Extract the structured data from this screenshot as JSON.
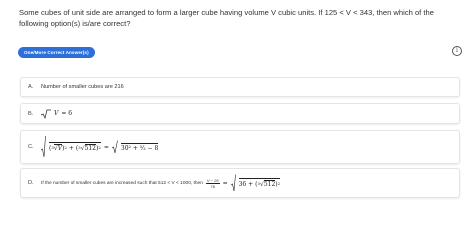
{
  "question": {
    "text": "Some cubes of unit side are arranged to form a larger cube having volume V cubic units. If 125 < V < 343, then which of the following option(s) is/are correct?"
  },
  "badge": {
    "label": "One/More Correct Answer(s)"
  },
  "info_icon": {
    "glyph": "i",
    "name": "info-icon"
  },
  "options": [
    {
      "letter": "A.",
      "text": "Number of smaller cubes are 216"
    },
    {
      "letter": "B.",
      "equals": "= 6",
      "var": "V"
    },
    {
      "letter": "C.",
      "var": "V",
      "n512": "512",
      "sum": "30² + ⁵⁄₂ − 8",
      "eq": "="
    },
    {
      "letter": "D.",
      "text": "If the number of smaller cubes are increased such that 512 < V < 1000, then",
      "frac_num": "V − 26",
      "frac_den": "76",
      "eq": "=",
      "inner": "36 +",
      "n512": "512"
    }
  ]
}
